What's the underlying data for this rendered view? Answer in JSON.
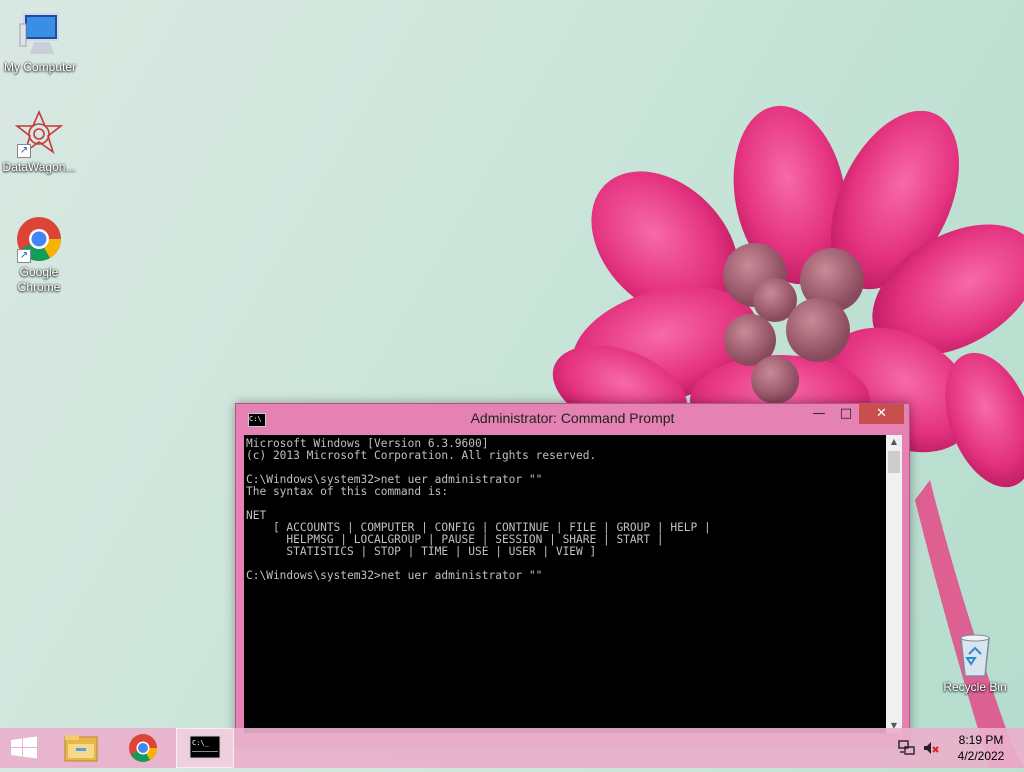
{
  "desktop": {
    "icons": [
      {
        "label": "My Computer"
      },
      {
        "label": "DataWagon..."
      },
      {
        "label": "Google Chrome"
      },
      {
        "label": "Recycle Bin"
      }
    ]
  },
  "window": {
    "title": "Administrator: Command Prompt",
    "min_glyph": "—",
    "max_glyph": "□",
    "close_glyph": "✕",
    "console_text": "Microsoft Windows [Version 6.3.9600]\n(c) 2013 Microsoft Corporation. All rights reserved.\n\nC:\\Windows\\system32>net uer administrator \"\"\nThe syntax of this command is:\n\nNET\n    [ ACCOUNTS | COMPUTER | CONFIG | CONTINUE | FILE | GROUP | HELP |\n      HELPMSG | LOCALGROUP | PAUSE | SESSION | SHARE | START |\n      STATISTICS | STOP | TIME | USE | USER | VIEW ]\n\nC:\\Windows\\system32>net uer administrator \"\""
  },
  "taskbar": {
    "clock_time": "8:19 PM",
    "clock_date": "4/2/2022"
  },
  "colors": {
    "window_border": "#e582b3",
    "close_button": "#c94f4f",
    "console_bg": "#000000",
    "console_text": "#c0c0c0"
  }
}
